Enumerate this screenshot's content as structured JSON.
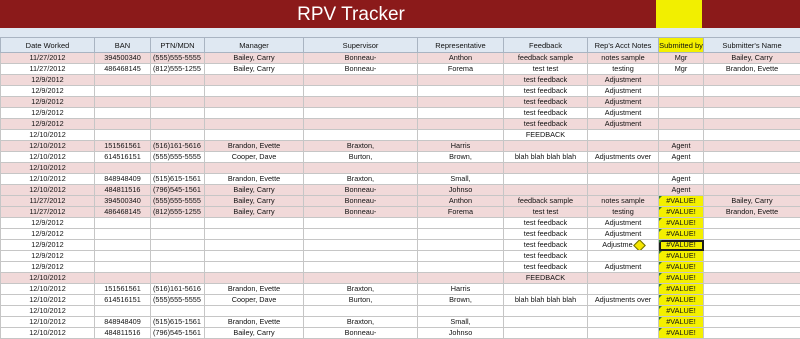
{
  "title": "RPV Tracker",
  "columns": [
    "Date Worked",
    "BAN",
    "PTN/MDN",
    "Manager",
    "Supervisor",
    "Representative",
    "Feedback",
    "Rep's Acct Notes",
    "Submitted by",
    "Submitter's Name"
  ],
  "rows": [
    {
      "tint": "pink",
      "cells": [
        "11/27/2012",
        "394500340",
        "(555)555-5555",
        "Bailey, Carry",
        "Bonneau-",
        "Anthon",
        "feedback sample",
        "notes sample",
        "Mgr",
        "Bailey, Carry"
      ]
    },
    {
      "tint": "white",
      "cells": [
        "11/27/2012",
        "486468145",
        "(812)555-1255",
        "Bailey, Carry",
        "Bonneau-",
        "Forema",
        "test test",
        "testing",
        "Mgr",
        "Brandon, Evette"
      ]
    },
    {
      "tint": "pink",
      "cells": [
        "12/9/2012",
        "",
        "",
        "",
        "",
        "",
        "test feedback",
        "Adjustment",
        "",
        ""
      ]
    },
    {
      "tint": "white",
      "cells": [
        "12/9/2012",
        "",
        "",
        "",
        "",
        "",
        "test feedback",
        "Adjustment",
        "",
        ""
      ]
    },
    {
      "tint": "pink",
      "cells": [
        "12/9/2012",
        "",
        "",
        "",
        "",
        "",
        "test feedback",
        "Adjustment",
        "",
        ""
      ]
    },
    {
      "tint": "white",
      "cells": [
        "12/9/2012",
        "",
        "",
        "",
        "",
        "",
        "test feedback",
        "Adjustment",
        "",
        ""
      ]
    },
    {
      "tint": "pink",
      "cells": [
        "12/9/2012",
        "",
        "",
        "",
        "",
        "",
        "test feedback",
        "Adjustment",
        "",
        ""
      ]
    },
    {
      "tint": "white",
      "cells": [
        "12/10/2012",
        "",
        "",
        "",
        "",
        "",
        "FEEDBACK",
        "",
        "",
        ""
      ]
    },
    {
      "tint": "pink",
      "cells": [
        "12/10/2012",
        "151561561",
        "(516)161-5616",
        "Brandon, Evette",
        "Braxton,",
        "Harris",
        "",
        "",
        "Agent",
        ""
      ]
    },
    {
      "tint": "white",
      "cells": [
        "12/10/2012",
        "614516151",
        "(555)555-5555",
        "Cooper, Dave",
        "Burton,",
        "Brown,",
        "blah blah blah blah",
        "Adjustments over",
        "Agent",
        ""
      ]
    },
    {
      "tint": "pink",
      "cells": [
        "12/10/2012",
        "",
        "",
        "",
        "",
        "",
        "",
        "",
        "",
        ""
      ]
    },
    {
      "tint": "white",
      "cells": [
        "12/10/2012",
        "848948409",
        "(515)615-1561",
        "Brandon, Evette",
        "Braxton,",
        "Small,",
        "",
        "",
        "Agent",
        ""
      ]
    },
    {
      "tint": "pink",
      "cells": [
        "12/10/2012",
        "484811516",
        "(796)545-1561",
        "Bailey, Carry",
        "Bonneau-",
        "Johnso",
        "",
        "",
        "Agent",
        ""
      ]
    },
    {
      "tint": "pink",
      "cells": [
        "11/27/2012",
        "394500340",
        "(555)555-5555",
        "Bailey, Carry",
        "Bonneau-",
        "Anthon",
        "feedback sample",
        "notes sample",
        "#VALUE!",
        "Bailey, Carry"
      ]
    },
    {
      "tint": "pink",
      "cells": [
        "11/27/2012",
        "486468145",
        "(812)555-1255",
        "Bailey, Carry",
        "Bonneau-",
        "Forema",
        "test test",
        "testing",
        "#VALUE!",
        "Brandon, Evette"
      ]
    },
    {
      "tint": "white",
      "cells": [
        "12/9/2012",
        "",
        "",
        "",
        "",
        "",
        "test feedback",
        "Adjustment",
        "#VALUE!",
        ""
      ]
    },
    {
      "tint": "white",
      "cells": [
        "12/9/2012",
        "",
        "",
        "",
        "",
        "",
        "test feedback",
        "Adjustment",
        "#VALUE!",
        ""
      ]
    },
    {
      "tint": "white",
      "cells": [
        "12/9/2012",
        "",
        "",
        "",
        "",
        "",
        "test feedback",
        "Adjustme",
        "#VALUE!",
        ""
      ]
    },
    {
      "tint": "white",
      "cells": [
        "12/9/2012",
        "",
        "",
        "",
        "",
        "",
        "test feedback",
        "",
        "#VALUE!",
        ""
      ]
    },
    {
      "tint": "white",
      "cells": [
        "12/9/2012",
        "",
        "",
        "",
        "",
        "",
        "test feedback",
        "Adjustment",
        "#VALUE!",
        ""
      ]
    },
    {
      "tint": "pink",
      "cells": [
        "12/10/2012",
        "",
        "",
        "",
        "",
        "",
        "FEEDBACK",
        "",
        "#VALUE!",
        ""
      ]
    },
    {
      "tint": "white",
      "cells": [
        "12/10/2012",
        "151561561",
        "(516)161-5616",
        "Brandon, Evette",
        "Braxton,",
        "Harris",
        "",
        "",
        "#VALUE!",
        ""
      ]
    },
    {
      "tint": "white",
      "cells": [
        "12/10/2012",
        "614516151",
        "(555)555-5555",
        "Cooper, Dave",
        "Burton,",
        "Brown,",
        "blah blah blah blah",
        "Adjustments over",
        "#VALUE!",
        ""
      ]
    },
    {
      "tint": "white",
      "cells": [
        "12/10/2012",
        "",
        "",
        "",
        "",
        "",
        "",
        "",
        "#VALUE!",
        ""
      ]
    },
    {
      "tint": "white",
      "cells": [
        "12/10/2012",
        "848948409",
        "(515)615-1561",
        "Brandon, Evette",
        "Braxton,",
        "Small,",
        "",
        "",
        "#VALUE!",
        ""
      ]
    },
    {
      "tint": "white",
      "cells": [
        "12/10/2012",
        "484811516",
        "(796)545-1561",
        "Bailey, Carry",
        "Bonneau-",
        "Johnso",
        "",
        "",
        "#VALUE!",
        ""
      ]
    }
  ],
  "colors": {
    "title_bg": "#8b1a1a",
    "header_bg": "#dfe8f2",
    "pink_row": "#f1d9d9",
    "highlight": "#f4f000"
  }
}
